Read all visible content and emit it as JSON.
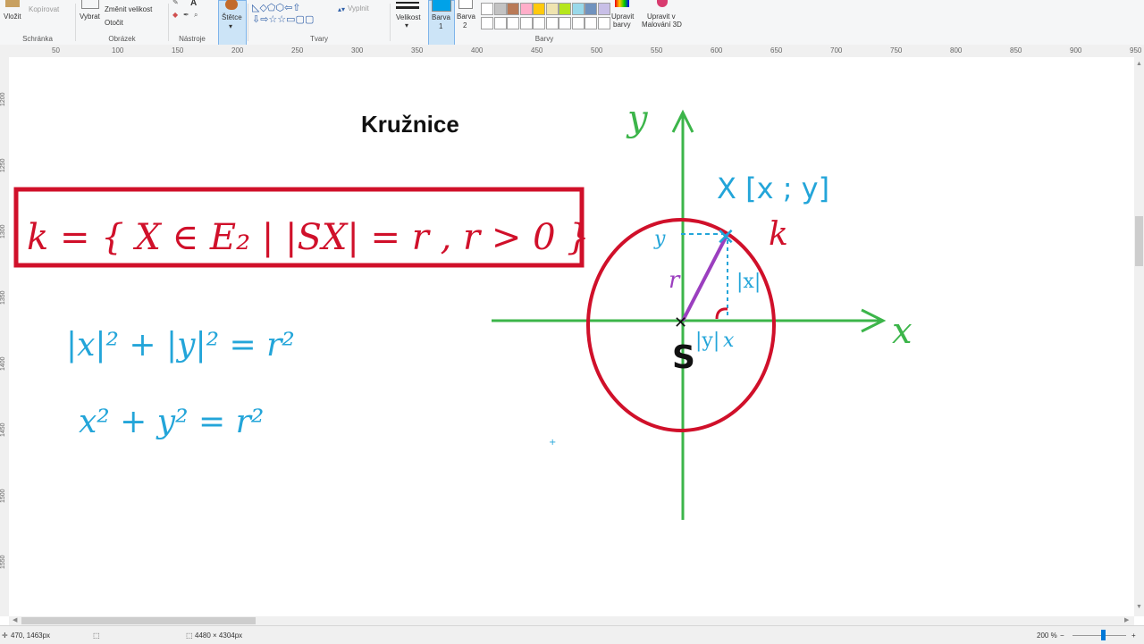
{
  "ribbon": {
    "clipboard": {
      "paste": "Vložit",
      "copy": "Kopírovat",
      "label": "Schránka"
    },
    "image": {
      "select": "Vybrat",
      "resize": "Změnit velikost",
      "rotate": "Otočit",
      "label": "Obrázek"
    },
    "tools": {
      "label": "Nástroje",
      "text_tool": "A"
    },
    "brushes": {
      "label": "Štětce"
    },
    "shapes": {
      "label": "Tvary",
      "fill": "Vyplnit"
    },
    "size": {
      "label": "Velikost"
    },
    "color1": {
      "label": "Barva",
      "num": "1"
    },
    "color2": {
      "label": "Barva",
      "num": "2"
    },
    "colors": {
      "label": "Barvy"
    },
    "edit_colors": {
      "line1": "Upravit",
      "line2": "barvy"
    },
    "paint3d": {
      "line1": "Upravit v",
      "line2": "Malování 3D"
    },
    "palette_row1": [
      "#ffffff",
      "#c3c3c3",
      "#b97a57",
      "#ffaec9",
      "#ffc90e",
      "#efe4b0",
      "#b5e61d",
      "#99d9ea",
      "#7092be",
      "#c8bfe7"
    ],
    "palette_row2": [
      "#ffffff",
      "#ffffff",
      "#ffffff",
      "#ffffff",
      "#ffffff",
      "#ffffff",
      "#ffffff",
      "#ffffff",
      "#ffffff",
      "#ffffff"
    ],
    "color1_value": "#00a2e8"
  },
  "ruler": {
    "ticks": [
      "50",
      "100",
      "150",
      "200",
      "250",
      "300",
      "350",
      "400",
      "450",
      "500",
      "550",
      "600",
      "650",
      "700",
      "750",
      "800",
      "850",
      "900",
      "950"
    ]
  },
  "vruler": {
    "ticks": [
      "1200",
      "1250",
      "1300",
      "1350",
      "1400",
      "1450",
      "1500",
      "1550"
    ]
  },
  "canvas": {
    "title": "Kružnice",
    "handwriting": {
      "definition": "k = { X ∈ E₂ | |SX| = r , r > 0 }",
      "eq1": "|x|² + |y|² = r²",
      "eq2": "x² + y² = r²",
      "axis_y": "y",
      "axis_x": "x",
      "point": "X [x ; y]",
      "circle_name": "k",
      "radius": "r",
      "center": "S",
      "len_x": "|x|",
      "len_y": "|y|",
      "y_mark": "y",
      "x_mark": "x"
    }
  },
  "status": {
    "cursor": "470, 1463px",
    "selection": "",
    "image_size": "4480 × 4304px",
    "zoom": "200 %"
  }
}
